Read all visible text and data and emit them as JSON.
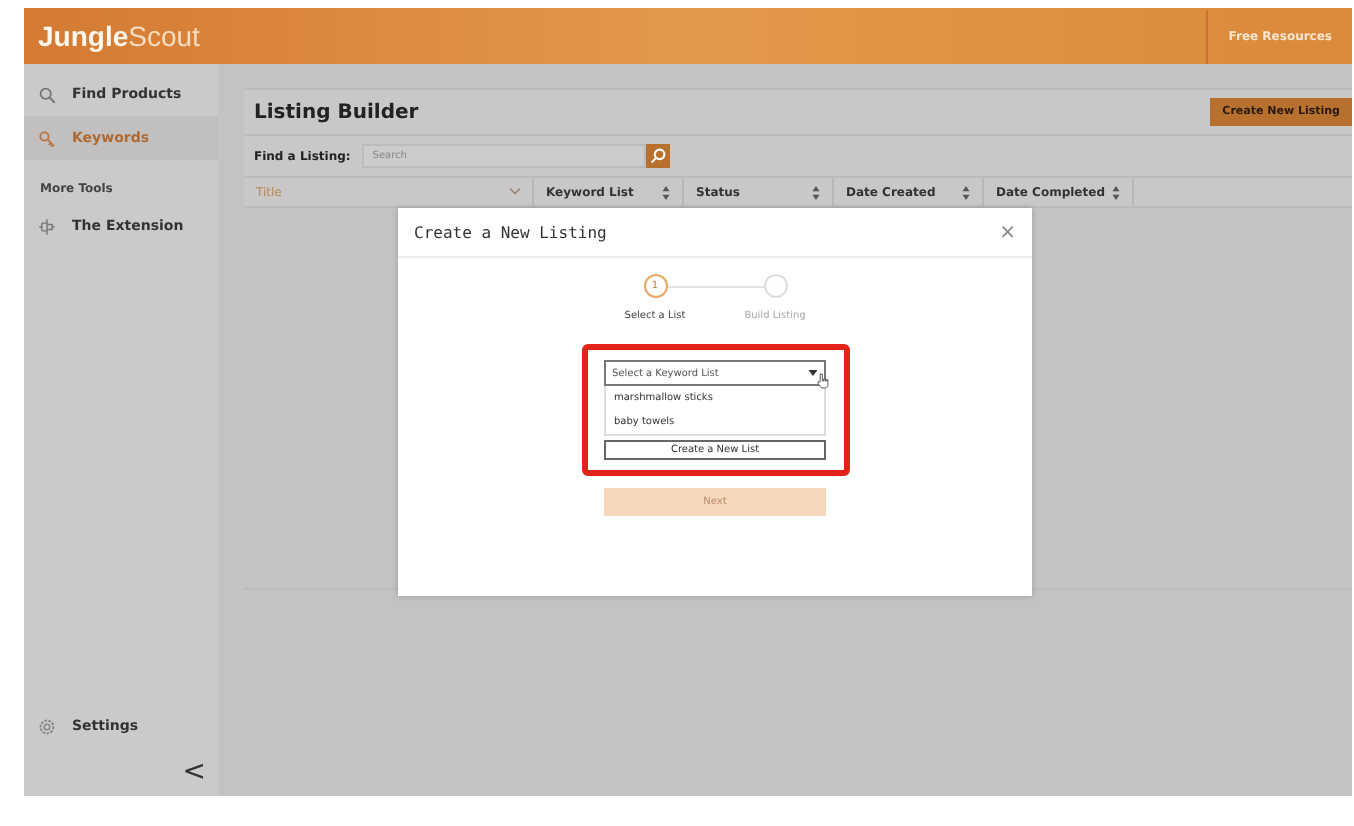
{
  "header": {
    "logo_bold": "Jungle",
    "logo_light": "Scout",
    "link": "Free Resources"
  },
  "sidebar": {
    "items": [
      {
        "kind": "search",
        "label": "Find Products",
        "selected": false
      },
      {
        "kind": "key",
        "label": "Keywords",
        "selected": true
      }
    ],
    "section": "More Tools",
    "tools": [
      {
        "kind": "extension",
        "label": "The Extension",
        "selected": false
      }
    ],
    "footer": {
      "kind": "settings",
      "label": "Settings"
    },
    "collapse": "<"
  },
  "page": {
    "title": "Listing Builder",
    "action": "Create New Listing",
    "search_label": "Find a Listing:",
    "search": {
      "placeholder": "Search"
    },
    "columns": [
      {
        "label": "Title",
        "sorted": true
      },
      {
        "label": "Keyword List",
        "sorted": false
      },
      {
        "label": "Status",
        "sorted": false
      },
      {
        "label": "Date Created",
        "sorted": false
      },
      {
        "label": "Date Completed",
        "sorted": false
      }
    ]
  },
  "dialog": {
    "title": "Create a New Listing",
    "close": "×",
    "steps": [
      {
        "number": "1",
        "label": "Select a List",
        "selected": true
      },
      {
        "label": "Build Listing",
        "selected": false
      }
    ],
    "select": {
      "placeholder": "Select a Keyword List",
      "expanded": true,
      "options": [
        "marshmallow sticks",
        "baby towels"
      ]
    },
    "create_button": "Create a New List",
    "next": {
      "label": "Next",
      "disabled": true
    }
  }
}
